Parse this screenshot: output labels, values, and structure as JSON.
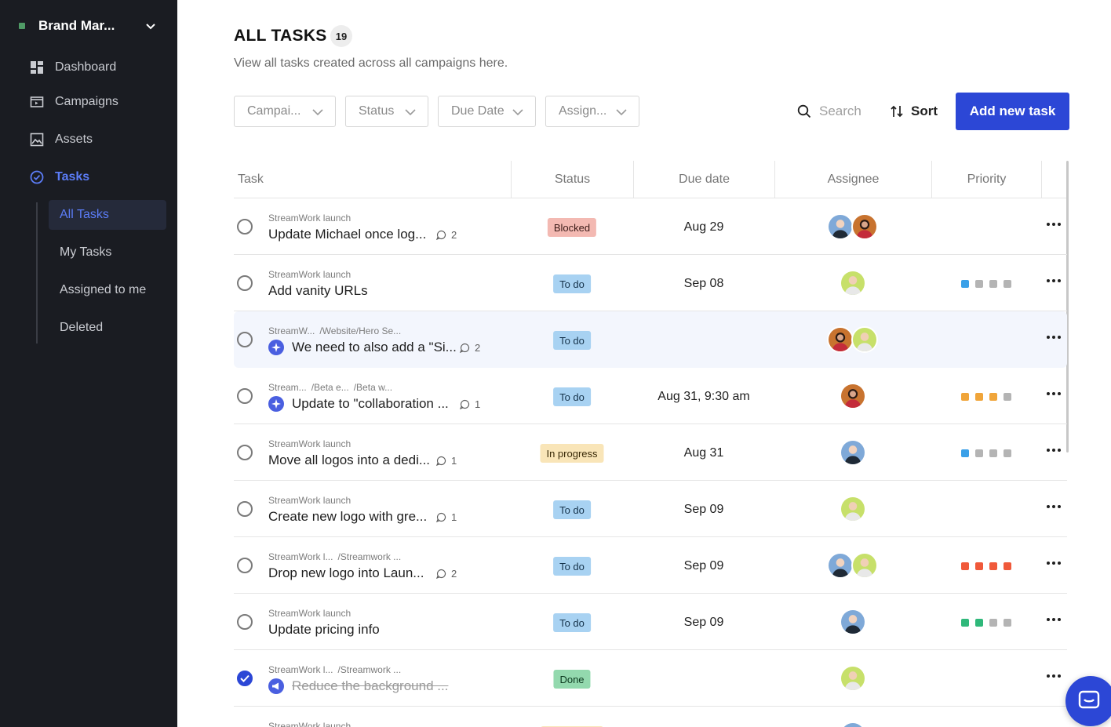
{
  "workspace": {
    "name": "Brand Mar..."
  },
  "nav": [
    {
      "label": "Dashboard"
    },
    {
      "label": "Campaigns"
    },
    {
      "label": "Assets"
    },
    {
      "label": "Tasks"
    }
  ],
  "subnav": [
    {
      "label": "All Tasks"
    },
    {
      "label": "My Tasks"
    },
    {
      "label": "Assigned to me"
    },
    {
      "label": "Deleted"
    }
  ],
  "header": {
    "title": "ALL TASKS",
    "count": "19",
    "subtitle": "View all tasks created across all campaigns here."
  },
  "filters": [
    {
      "label": "Campai..."
    },
    {
      "label": "Status"
    },
    {
      "label": "Due Date"
    },
    {
      "label": "Assign..."
    }
  ],
  "toolbar": {
    "search_placeholder": "Search",
    "sort_label": "Sort",
    "add_label": "Add new task"
  },
  "columns": [
    "Task",
    "Status",
    "Due date",
    "Assignee",
    "Priority"
  ],
  "colors": {
    "accent": "#2c47d6",
    "sidebar_bg": "#1a1c22",
    "blocked": "#f3b9b2",
    "todo": "#a8d2f2",
    "in_progress": "#f9e5b8",
    "done": "#93d9ae"
  },
  "rows": [
    {
      "crumb": [
        "StreamWork launch"
      ],
      "name": "Update Michael once log...",
      "comments": "2",
      "status": "Blocked",
      "due": "Aug 29",
      "assignees": [
        "blue",
        "dark"
      ],
      "priority": null
    },
    {
      "crumb": [
        "StreamWork launch"
      ],
      "name": "Add vanity URLs",
      "comments": null,
      "status": "To do",
      "due": "Sep 08",
      "assignees": [
        "green"
      ],
      "priority": "low"
    },
    {
      "crumb": [
        "StreamW...",
        "/Website/Hero Se..."
      ],
      "name": "We need to also add a \"Si...",
      "comments": "2",
      "status": "To do",
      "due": "",
      "assignees": [
        "dark",
        "green"
      ],
      "priority": null,
      "subtask": true
    },
    {
      "crumb": [
        "Stream...",
        "/Beta e...",
        "/Beta w..."
      ],
      "name": "Update to \"collaboration ...",
      "comments": "1",
      "status": "To do",
      "due": "Aug 31, 9:30 am",
      "assignees": [
        "dark"
      ],
      "priority": "high",
      "subtask": true
    },
    {
      "crumb": [
        "StreamWork launch"
      ],
      "name": "Move all logos into a dedi...",
      "comments": "1",
      "status": "In progress",
      "due": "Aug 31",
      "assignees": [
        "blue"
      ],
      "priority": "low"
    },
    {
      "crumb": [
        "StreamWork launch"
      ],
      "name": "Create new logo with gre...",
      "comments": "1",
      "status": "To do",
      "due": "Sep 09",
      "assignees": [
        "green"
      ],
      "priority": null
    },
    {
      "crumb": [
        "StreamWork l...",
        "/Streamwork ..."
      ],
      "name": "Drop new logo into Laun...",
      "comments": "2",
      "status": "To do",
      "due": "Sep 09",
      "assignees": [
        "blue",
        "green"
      ],
      "priority": "urgent"
    },
    {
      "crumb": [
        "StreamWork launch"
      ],
      "name": "Update pricing info",
      "comments": null,
      "status": "To do",
      "due": "Sep 09",
      "assignees": [
        "blue"
      ],
      "priority": "medium"
    },
    {
      "crumb": [
        "StreamWork l...",
        "/Streamwork ..."
      ],
      "name": "Reduce the background ...",
      "comments": null,
      "status": "Done",
      "due": "",
      "assignees": [
        "green"
      ],
      "priority": null,
      "done": true,
      "subtask": true
    },
    {
      "crumb": [
        "StreamWork launch"
      ],
      "name": "",
      "comments": null,
      "status": "",
      "due": "",
      "assignees": [
        "blue"
      ],
      "priority": null
    }
  ]
}
